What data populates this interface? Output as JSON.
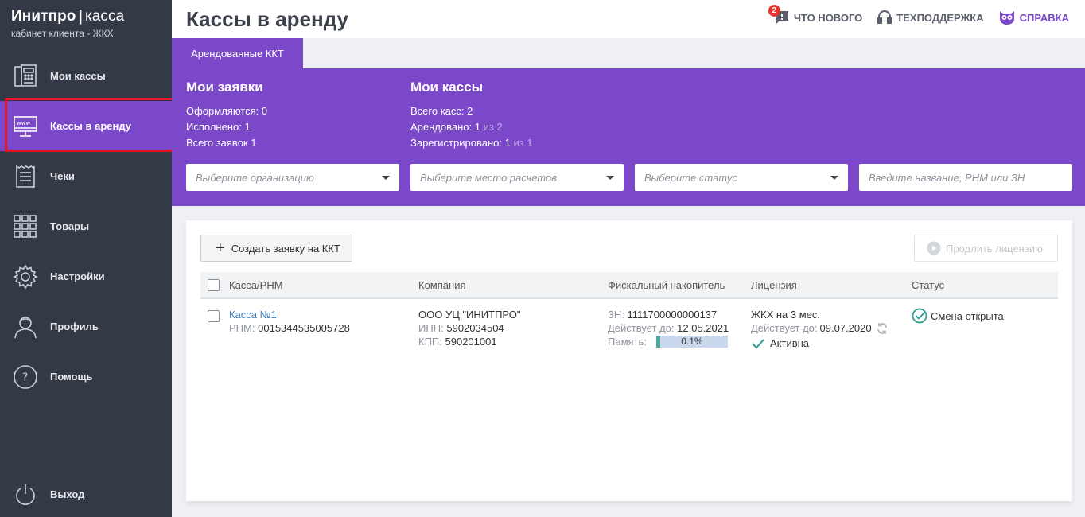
{
  "brand": {
    "name": "Инитпро",
    "separator": "|",
    "product": "касса",
    "subtitle": "кабинет клиента - ЖКХ"
  },
  "sidebar": {
    "items": [
      {
        "label": "Мои кассы",
        "icon": "cash-register-icon"
      },
      {
        "label": "Кассы в аренду",
        "icon": "monitor-www-icon",
        "active": true
      },
      {
        "label": "Чеки",
        "icon": "receipt-icon"
      },
      {
        "label": "Товары",
        "icon": "grid-icon"
      },
      {
        "label": "Настройки",
        "icon": "gear-icon"
      },
      {
        "label": "Профиль",
        "icon": "user-icon"
      },
      {
        "label": "Помощь",
        "icon": "help-icon"
      }
    ],
    "logout": {
      "label": "Выход",
      "icon": "power-icon"
    }
  },
  "header": {
    "title": "Кассы в аренду",
    "links": {
      "news": {
        "label": "ЧТО НОВОГО",
        "badge": "2"
      },
      "support": {
        "label": "ТЕХПОДДЕРЖКА"
      },
      "help": {
        "label": "СПРАВКА"
      }
    }
  },
  "tabs": [
    {
      "label": "Арендованные ККТ"
    }
  ],
  "requests": {
    "title": "Мои заявки",
    "processing": "Оформляются: 0",
    "done": "Исполнено: 1",
    "total": "Всего заявок 1"
  },
  "registers": {
    "title": "Мои кассы",
    "total": "Всего касс: 2",
    "rented_label": "Арендовано:",
    "rented_value": "1",
    "rented_of": "из 2",
    "registered_label": "Зарегистрировано:",
    "registered_value": "1",
    "registered_of": "из 1"
  },
  "filters": {
    "org": "Выберите организацию",
    "place": "Выберите место расчетов",
    "status": "Выберите статус",
    "search": "Введите название, РНМ или ЗН"
  },
  "actions": {
    "create": "Создать заявку на ККТ",
    "extend": "Продлить лицензию"
  },
  "table": {
    "headers": {
      "kassa": "Касса/РНМ",
      "company": "Компания",
      "fn": "Фискальный накопитель",
      "license": "Лицензия",
      "status": "Статус"
    },
    "rows": [
      {
        "name": "Касса №1",
        "rnm_label": "РНМ:",
        "rnm": "0015344535005728",
        "company": "ООО УЦ \"ИНИТПРО\"",
        "inn_label": "ИНН:",
        "inn": "5902034504",
        "kpp_label": "КПП:",
        "kpp": "590201001",
        "zn_label": "ЗН:",
        "zn": "1111700000000137",
        "fn_valid_label": "Действует до:",
        "fn_valid": "12.05.2021",
        "memory_label": "Память:",
        "memory": "0.1%",
        "memory_fraction": 0.001,
        "license": "ЖКХ на 3 мес.",
        "lic_valid_label": "Действует до:",
        "lic_valid": "09.07.2020",
        "lic_state": "Активна",
        "status": "Смена открыта"
      }
    ]
  },
  "colors": {
    "sidebar": "#333a46",
    "accent": "#7a48c9",
    "highlight": "#e8121e",
    "link": "#3b7ec8",
    "ok": "#2a9d8f"
  }
}
